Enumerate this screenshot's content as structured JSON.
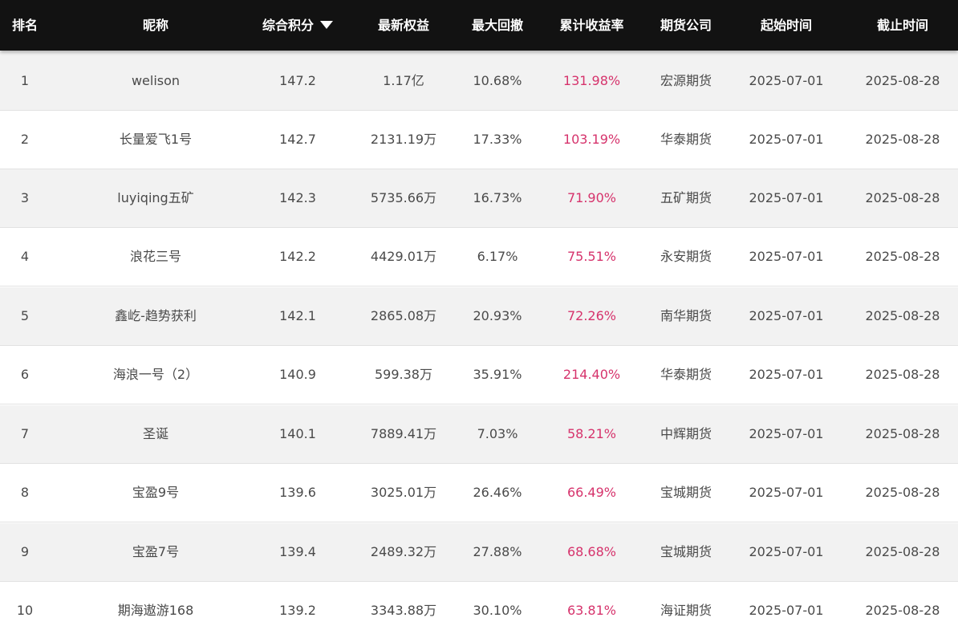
{
  "header": {
    "rank": "排名",
    "nickname": "昵称",
    "score": "综合积分",
    "equity": "最新权益",
    "max_drawdown": "最大回撤",
    "cum_return": "累计收益率",
    "futures_company": "期货公司",
    "start_time": "起始时间",
    "end_time": "截止时间",
    "sort_icon": "caret-down-icon"
  },
  "colors": {
    "header_bg": "#121212",
    "row_alt_bg": "#f2f2f2",
    "return_text": "#d6336c",
    "body_text": "#4a4a4a"
  },
  "rows": [
    {
      "rank": "1",
      "nickname": "welison",
      "score": "147.2",
      "equity": "1.17亿",
      "max_drawdown": "10.68%",
      "cum_return": "131.98%",
      "futures_company": "宏源期货",
      "start_time": "2025-07-01",
      "end_time": "2025-08-28"
    },
    {
      "rank": "2",
      "nickname": "长量爱飞1号",
      "score": "142.7",
      "equity": "2131.19万",
      "max_drawdown": "17.33%",
      "cum_return": "103.19%",
      "futures_company": "华泰期货",
      "start_time": "2025-07-01",
      "end_time": "2025-08-28"
    },
    {
      "rank": "3",
      "nickname": "luyiqing五矿",
      "score": "142.3",
      "equity": "5735.66万",
      "max_drawdown": "16.73%",
      "cum_return": "71.90%",
      "futures_company": "五矿期货",
      "start_time": "2025-07-01",
      "end_time": "2025-08-28"
    },
    {
      "rank": "4",
      "nickname": "浪花三号",
      "score": "142.2",
      "equity": "4429.01万",
      "max_drawdown": "6.17%",
      "cum_return": "75.51%",
      "futures_company": "永安期货",
      "start_time": "2025-07-01",
      "end_time": "2025-08-28"
    },
    {
      "rank": "5",
      "nickname": "鑫屹-趋势获利",
      "score": "142.1",
      "equity": "2865.08万",
      "max_drawdown": "20.93%",
      "cum_return": "72.26%",
      "futures_company": "南华期货",
      "start_time": "2025-07-01",
      "end_time": "2025-08-28"
    },
    {
      "rank": "6",
      "nickname": "海浪一号（2）",
      "score": "140.9",
      "equity": "599.38万",
      "max_drawdown": "35.91%",
      "cum_return": "214.40%",
      "futures_company": "华泰期货",
      "start_time": "2025-07-01",
      "end_time": "2025-08-28"
    },
    {
      "rank": "7",
      "nickname": "圣诞",
      "score": "140.1",
      "equity": "7889.41万",
      "max_drawdown": "7.03%",
      "cum_return": "58.21%",
      "futures_company": "中辉期货",
      "start_time": "2025-07-01",
      "end_time": "2025-08-28"
    },
    {
      "rank": "8",
      "nickname": "宝盈9号",
      "score": "139.6",
      "equity": "3025.01万",
      "max_drawdown": "26.46%",
      "cum_return": "66.49%",
      "futures_company": "宝城期货",
      "start_time": "2025-07-01",
      "end_time": "2025-08-28"
    },
    {
      "rank": "9",
      "nickname": "宝盈7号",
      "score": "139.4",
      "equity": "2489.32万",
      "max_drawdown": "27.88%",
      "cum_return": "68.68%",
      "futures_company": "宝城期货",
      "start_time": "2025-07-01",
      "end_time": "2025-08-28"
    },
    {
      "rank": "10",
      "nickname": "期海遨游168",
      "score": "139.2",
      "equity": "3343.88万",
      "max_drawdown": "30.10%",
      "cum_return": "63.81%",
      "futures_company": "海证期货",
      "start_time": "2025-07-01",
      "end_time": "2025-08-28"
    }
  ]
}
